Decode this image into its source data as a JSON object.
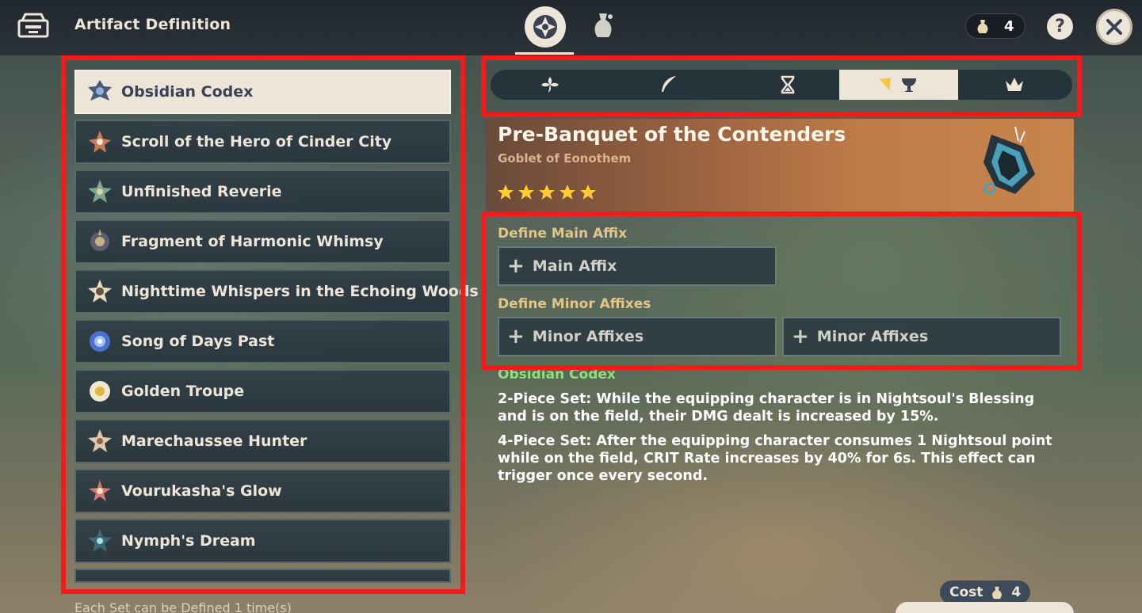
{
  "header": {
    "title": "Artifact Definition",
    "currency_count": "4",
    "help_label": "?"
  },
  "sets": [
    {
      "label": "Obsidian Codex",
      "icon": "obsidian-codex-icon",
      "selected": true
    },
    {
      "label": "Scroll of the Hero of Cinder City",
      "icon": "scroll-cinder-city-icon"
    },
    {
      "label": "Unfinished Reverie",
      "icon": "unfinished-reverie-icon"
    },
    {
      "label": "Fragment of Harmonic Whimsy",
      "icon": "harmonic-whimsy-icon"
    },
    {
      "label": "Nighttime Whispers in the Echoing Woods",
      "icon": "nighttime-whispers-icon"
    },
    {
      "label": "Song of Days Past",
      "icon": "song-of-days-past-icon"
    },
    {
      "label": "Golden Troupe",
      "icon": "golden-troupe-icon"
    },
    {
      "label": "Marechaussee Hunter",
      "icon": "marechaussee-hunter-icon"
    },
    {
      "label": "Vourukasha's Glow",
      "icon": "vourukashas-glow-icon"
    },
    {
      "label": "Nymph's Dream",
      "icon": "nymphs-dream-icon"
    }
  ],
  "footer_note": "Each Set can be Defined 1 time(s)",
  "slot_tabs": [
    {
      "icon": "flower-icon",
      "active": false
    },
    {
      "icon": "feather-icon",
      "active": false
    },
    {
      "icon": "hourglass-icon",
      "active": false
    },
    {
      "icon": "goblet-icon",
      "active": true
    },
    {
      "icon": "crown-icon",
      "active": false
    }
  ],
  "artifact": {
    "name": "Pre-Banquet of the Contenders",
    "slot_name": "Goblet of Eonothem",
    "rarity": 5
  },
  "affix": {
    "main_section_label": "Define Main Affix",
    "main_button_label": "Main Affix",
    "minor_section_label": "Define Minor Affixes",
    "minor_button_labels": [
      "Minor Affixes",
      "Minor Affixes"
    ]
  },
  "set_effect": {
    "set_name": "Obsidian Codex",
    "two_piece": "2-Piece Set: While the equipping character is in Nightsoul's Blessing and is on the field, their DMG dealt is increased by 15%.",
    "four_piece": "4-Piece Set: After the equipping character consumes 1 Nightsoul point while on the field, CRIT Rate increases by 40% for 6s. This effect can trigger once every second."
  },
  "cost": {
    "label": "Cost",
    "value": "4"
  },
  "colors": {
    "highlight": "#f41a1a",
    "accent_cream": "#ece5d8",
    "set_name_green": "#8fe07d",
    "section_gold": "#e0c68a",
    "star": "#ffcc33"
  }
}
